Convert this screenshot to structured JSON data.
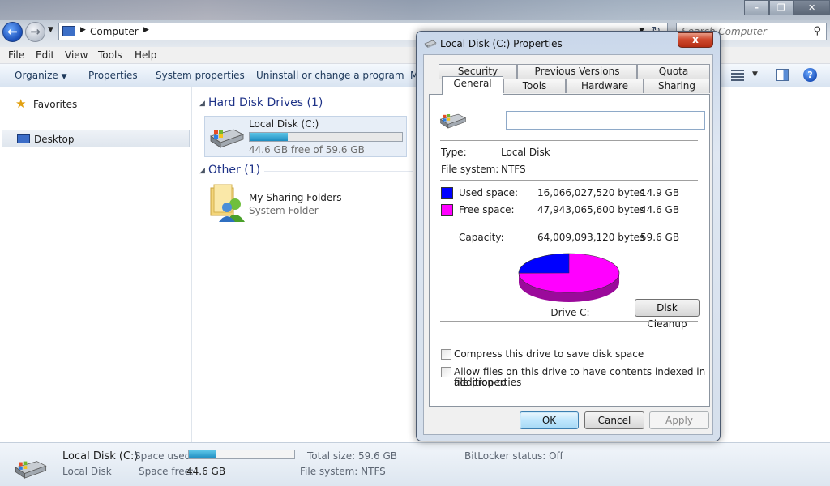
{
  "address": {
    "crumb": "Computer"
  },
  "search": {
    "placeholder": "Search Computer"
  },
  "menu": [
    "File",
    "Edit",
    "View",
    "Tools",
    "Help"
  ],
  "commands": {
    "organize": "Organize",
    "properties": "Properties",
    "system_properties": "System properties",
    "uninstall": "Uninstall or change a program",
    "map": "M"
  },
  "nav": {
    "favorites": "Favorites",
    "desktop": "Desktop"
  },
  "content": {
    "hdd_group": "Hard Disk Drives (1)",
    "other_group": "Other (1)",
    "drive_name": "Local Disk (C:)",
    "drive_free": "44.6 GB free of 59.6 GB",
    "drive_used_fraction": 0.25,
    "sharing_name": "My Sharing Folders",
    "sharing_type": "System Folder"
  },
  "status": {
    "drive_name": "Local Disk (C:)",
    "drive_type": "Local Disk",
    "space_used_label": "Space used:",
    "space_free_label": "Space free:",
    "space_free_value": "44.6 GB",
    "total_size": "Total size: 59.6 GB",
    "file_system": "File system: NTFS",
    "bitlocker": "BitLocker status: Off",
    "used_fraction": 0.25
  },
  "dialog": {
    "title": "Local Disk (C:) Properties",
    "close": "x",
    "tabs_back": [
      "Security",
      "Previous Versions",
      "Quota"
    ],
    "tabs_front": [
      "General",
      "Tools",
      "Hardware",
      "Sharing"
    ],
    "name_value": "",
    "type_label": "Type:",
    "type_value": "Local Disk",
    "fs_label": "File system:",
    "fs_value": "NTFS",
    "used_label": "Used space:",
    "used_bytes": "16,066,027,520 bytes",
    "used_gb": "14.9 GB",
    "free_label": "Free space:",
    "free_bytes": "47,943,065,600 bytes",
    "free_gb": "44.6 GB",
    "capacity_label": "Capacity:",
    "capacity_bytes": "64,009,093,120 bytes",
    "capacity_gb": "59.6 GB",
    "drive_label": "Drive C:",
    "cleanup": "Disk Cleanup",
    "compress": "Compress this drive to save disk space",
    "index_line1": "Allow files on this drive to have contents indexed in addition to",
    "index_line2": "file properties",
    "ok": "OK",
    "cancel": "Cancel",
    "apply": "Apply",
    "colors": {
      "used": "#0000ff",
      "free": "#ff00ff"
    },
    "used_fraction": 0.251
  }
}
